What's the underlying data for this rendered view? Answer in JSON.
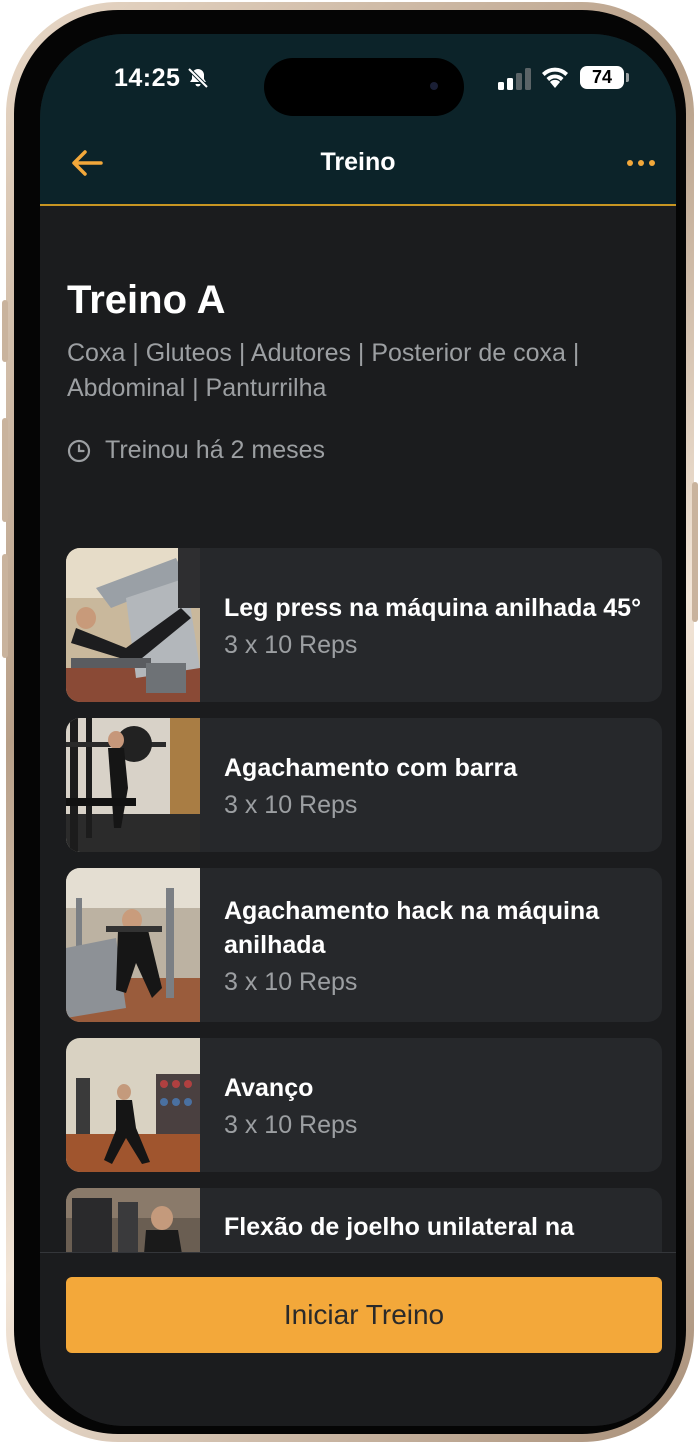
{
  "status_bar": {
    "time": "14:25",
    "battery": "74"
  },
  "nav": {
    "title": "Treino"
  },
  "workout": {
    "title": "Treino A",
    "muscle_groups": "Coxa | Gluteos | Adutores | Posterior de coxa | Abdominal | Panturrilha",
    "last_trained": "Treinou há 2 meses"
  },
  "exercises": [
    {
      "name": "Leg press na máquina anilhada 45°",
      "reps": "3 x 10 Reps"
    },
    {
      "name": "Agachamento com barra",
      "reps": "3 x 10 Reps"
    },
    {
      "name": "Agachamento hack na máquina anilhada",
      "reps": "3 x 10 Reps"
    },
    {
      "name": "Avanço",
      "reps": "3 x 10 Reps"
    },
    {
      "name": "Flexão de joelho unilateral na",
      "reps": ""
    }
  ],
  "actions": {
    "start_label": "Iniciar Treino"
  },
  "colors": {
    "accent": "#F3A83A",
    "header_bg": "#0C2329",
    "screen_bg": "#1B1C1E",
    "card_bg": "#26282B"
  }
}
